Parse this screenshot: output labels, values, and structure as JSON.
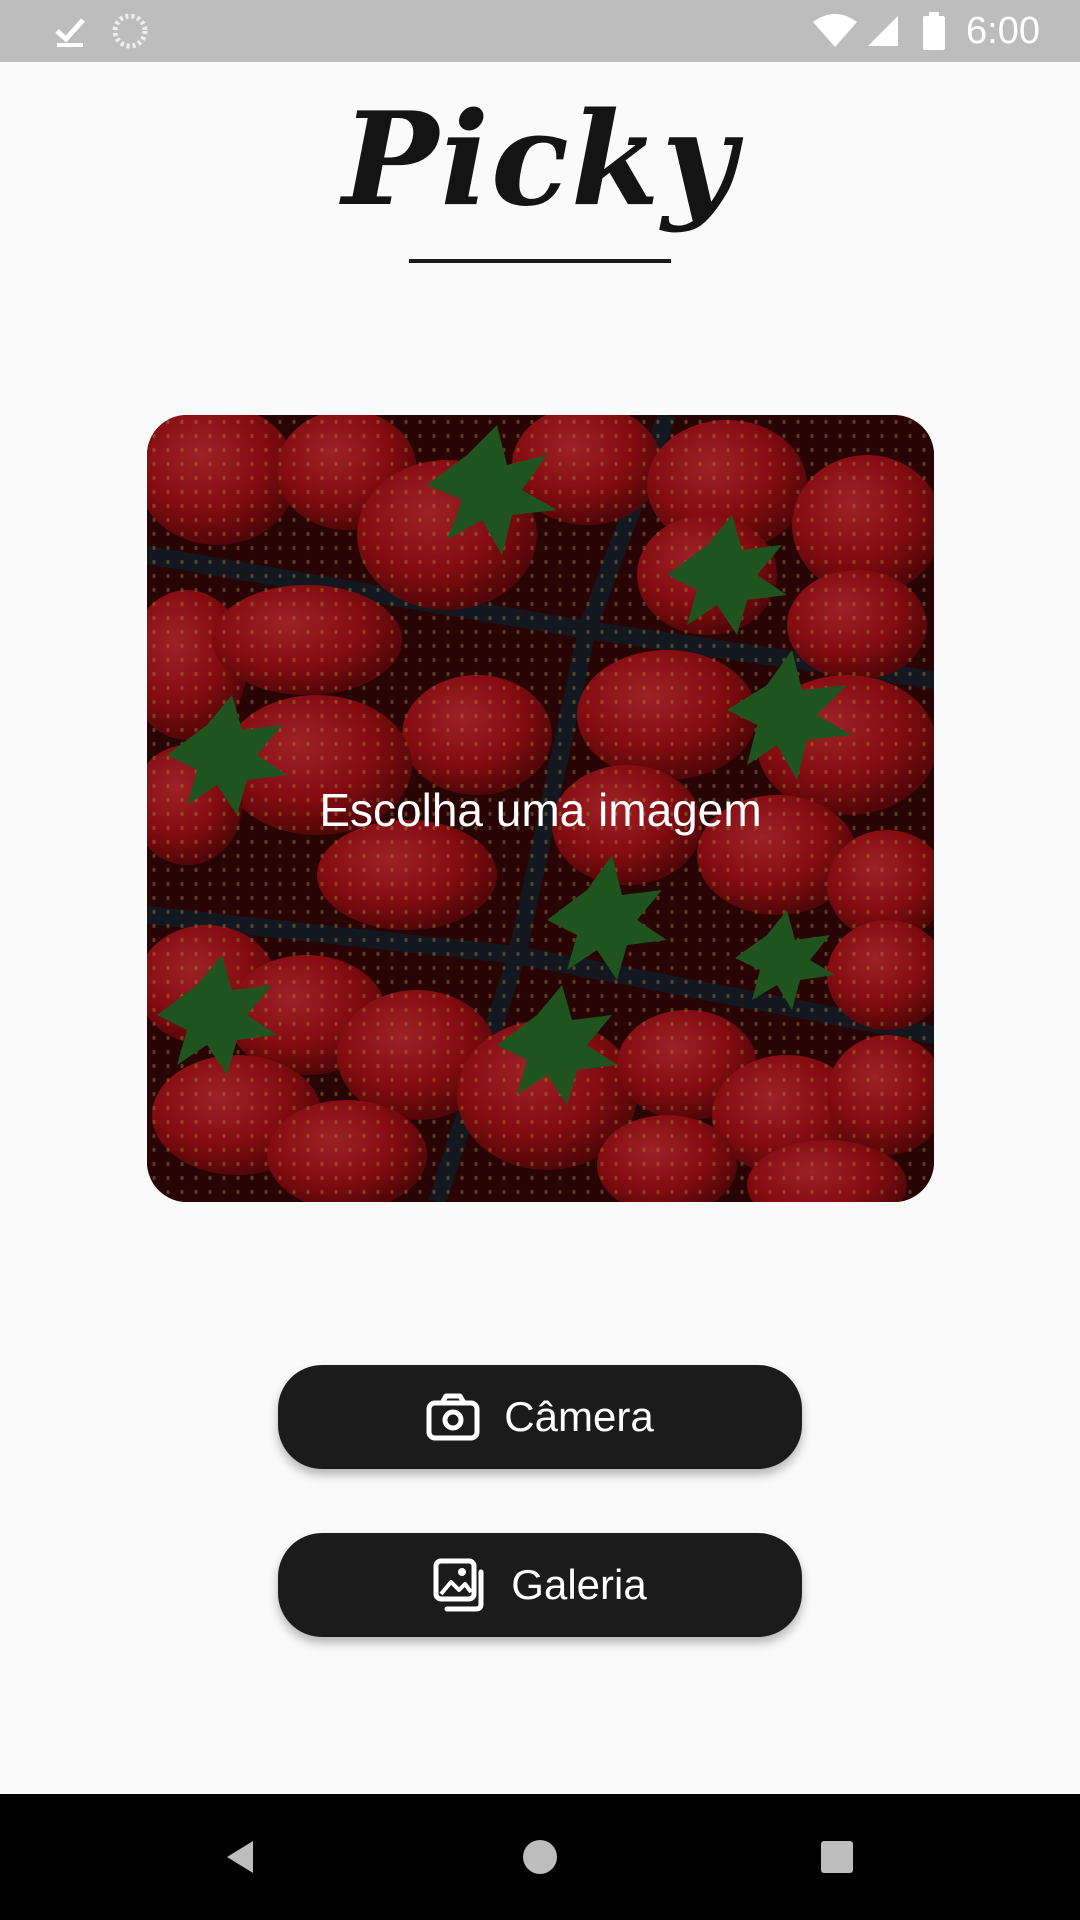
{
  "status_bar": {
    "time": "6:00",
    "icons": [
      "download-done-icon",
      "sync-icon",
      "wifi-icon",
      "cell-signal-icon",
      "battery-icon"
    ]
  },
  "app": {
    "logo_text": "Picky"
  },
  "image_card": {
    "caption": "Escolha uma imagem",
    "image_subject": "strawberries in cartons"
  },
  "buttons": {
    "camera_label": "Câmera",
    "gallery_label": "Galeria",
    "camera_icon": "camera-icon",
    "gallery_icon": "gallery-icon"
  },
  "nav_bar": {
    "icons": [
      "back-icon",
      "home-icon",
      "recents-icon"
    ]
  },
  "colors": {
    "background": "#fafafa",
    "button": "#1b1b1b",
    "status_bar": "#bdbdbd",
    "strawberry": "#c8141c",
    "leaf": "#2e7d32"
  }
}
